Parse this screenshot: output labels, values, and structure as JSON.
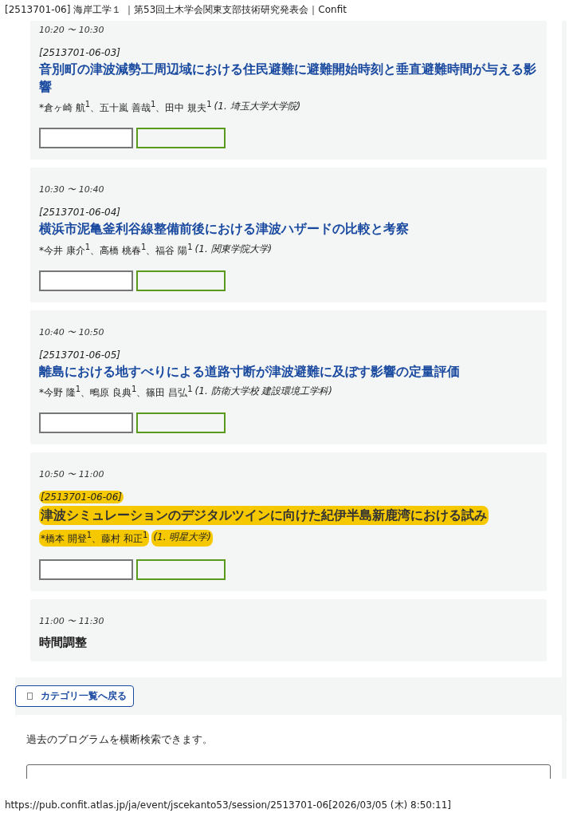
{
  "header": "[2513701-06] 海岸工学１ ｜第53回土木学会関東支部技術研究発表会｜Confit",
  "sessions": [
    {
      "kind": "presentation",
      "time_start": "10:20",
      "tilde": "〜",
      "time_end": "10:30",
      "code": "[2513701-06-03]",
      "title": "音別町の津波減勢工周辺域における住民避難に避難開始時刻と垂直避難時間が与える影響",
      "authors": "*倉ヶ崎 航$^{1}$、五十嵐 善哉$^{1}$、田中 規夫$^{1}$",
      "affiliation": "(1. 埼玉大学大学院)",
      "highlighted": false
    },
    {
      "kind": "presentation",
      "time_start": "10:30",
      "tilde": "〜",
      "time_end": "10:40",
      "code": "[2513701-06-04]",
      "title": "横浜市泥亀釜利谷線整備前後における津波ハザードの比較と考察",
      "authors": "*今井 康介$^{1}$、高橋 桃春$^{1}$、福谷 陽$^{1}$",
      "affiliation": "(1. 関東学院大学)",
      "highlighted": false
    },
    {
      "kind": "presentation",
      "time_start": "10:40",
      "tilde": "〜",
      "time_end": "10:50",
      "code": "[2513701-06-05]",
      "title": "離島における地すべりによる道路寸断が津波避難に及ぼす影響の定量評価",
      "authors": "*今野 隆$^{1}$、鴫原 良典$^{1}$、篠田 昌弘$^{1}$",
      "affiliation": "(1. 防衛大学校 建設環境工学科)",
      "highlighted": false
    },
    {
      "kind": "presentation",
      "time_start": "10:50",
      "tilde": "〜",
      "time_end": "11:00",
      "code": "[2513701-06-06]",
      "title": "津波シミュレーションのデジタルツインに向けた紀伊半島新鹿湾における試み",
      "authors": "*橋本 開登$^{1}$、藤村 和正$^{1}$",
      "affiliation": "(1. 明星大学)",
      "highlighted": true
    },
    {
      "kind": "break",
      "time_start": "11:00",
      "tilde": "〜",
      "time_end": "11:30",
      "title": "時間調整"
    }
  ],
  "back_button": "カテゴリ一覧へ戻る",
  "search_note": "過去のプログラムを横断検索できます。",
  "footer": "https://pub.confit.atlas.jp/ja/event/jscekanto53/session/2513701-06[2026/03/05 (木) 8:50:11]"
}
